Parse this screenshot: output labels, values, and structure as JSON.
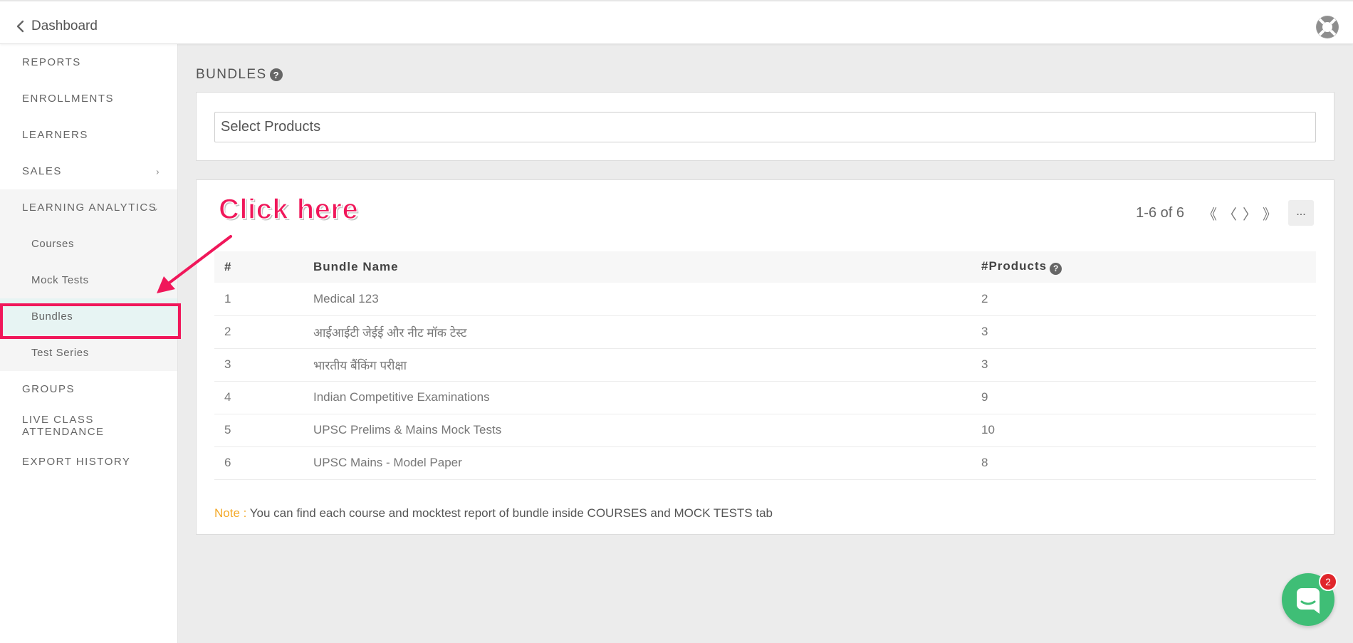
{
  "header": {
    "back_label": "Dashboard",
    "help_icon": "lifebuoy-icon"
  },
  "sidebar": {
    "items": [
      {
        "label": "REPORTS"
      },
      {
        "label": "ENROLLMENTS"
      },
      {
        "label": "LEARNERS"
      },
      {
        "label": "SALES",
        "chevron": "›"
      },
      {
        "label": "LEARNING ANALYTICS",
        "chevron": "⌄"
      },
      {
        "label": "GROUPS"
      },
      {
        "label": "LIVE CLASS ATTENDANCE"
      },
      {
        "label": "EXPORT HISTORY"
      }
    ],
    "sub_items": [
      {
        "label": "Courses"
      },
      {
        "label": "Mock Tests"
      },
      {
        "label": "Bundles",
        "active": true
      },
      {
        "label": "Test Series"
      }
    ]
  },
  "main": {
    "title": "BUNDLES",
    "help_glyph": "?",
    "select": {
      "placeholder": "Select Products"
    },
    "pagination": {
      "range": "1-6 of 6",
      "first": "《",
      "prev": "〈",
      "next": "〉",
      "last": "》",
      "more": "..."
    },
    "table": {
      "headers": [
        "#",
        "Bundle Name",
        "#Products"
      ],
      "rows": [
        {
          "num": "1",
          "name": "Medical 123",
          "products": "2"
        },
        {
          "num": "2",
          "name": "आईआईटी जेईई और नीट मॉक टेस्ट",
          "products": "3"
        },
        {
          "num": "3",
          "name": "भारतीय बैंकिंग परीक्षा",
          "products": "3"
        },
        {
          "num": "4",
          "name": "Indian Competitive Examinations",
          "products": "9"
        },
        {
          "num": "5",
          "name": "UPSC Prelims & Mains Mock Tests",
          "products": "10"
        },
        {
          "num": "6",
          "name": "UPSC Mains - Model Paper",
          "products": "8"
        }
      ]
    },
    "note": {
      "label": "Note :",
      "text": " You can find each course and mocktest report of bundle inside COURSES and MOCK TESTS tab"
    }
  },
  "annotation": {
    "callout": "Click here",
    "color": "#f0175a"
  },
  "chat": {
    "badge": "2",
    "color": "#3fbe76"
  }
}
